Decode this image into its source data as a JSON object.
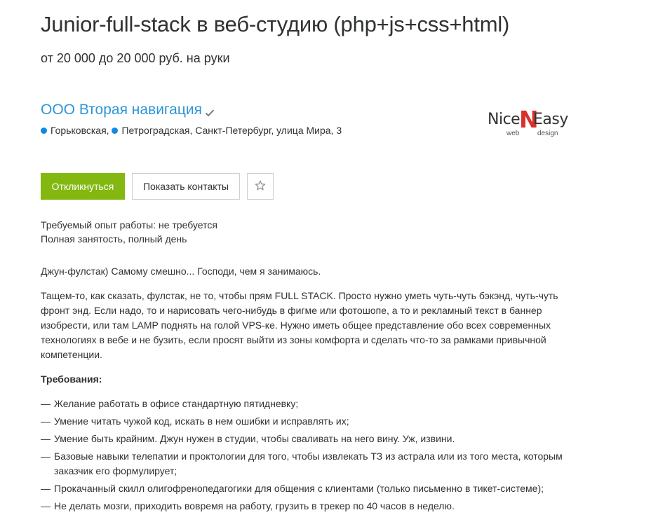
{
  "vacancy": {
    "title": "Junior-full-stack в веб-студию (php+js+css+html)",
    "salary": "от 20 000 до 20 000 руб. на руки"
  },
  "company": {
    "name": "ООО Вторая навигация",
    "verified_icon": "check-icon",
    "address": {
      "metro_1": "Горьковская",
      "metro_2": "Петроградская",
      "separator": ", ",
      "rest": ", Санкт-Петербург, улица Мира, 3",
      "metro_color": "#0f8ae0"
    },
    "logo": {
      "part1": "Nice",
      "part2": "N",
      "part3": "Easy",
      "sub1": "web",
      "sub2": "design",
      "accent_color": "#d9302c"
    }
  },
  "actions": {
    "apply_label": "Откликнуться",
    "contacts_label": "Показать контакты",
    "favorite_icon": "star-icon",
    "apply_color": "#82b80f"
  },
  "conditions": {
    "experience": "Требуемый опыт работы: не требуется",
    "employment": "Полная занятость, полный день"
  },
  "description": {
    "intro": "Джун-фулстак) Самому смешно... Господи, чем я занимаюсь.",
    "body": "Тащем-то, как сказать, фулстак, не то, чтобы прям FULL STACK. Просто нужно уметь чуть-чуть бэкэнд, чуть-чуть фронт энд. Если надо, то и нарисовать чего-нибудь в фигме или фотошопе, а то и рекламный текст в баннер изобрести, или там LAMP поднять на голой VPS-ке. Нужно иметь общее представление обо всех современных технологиях в вебе и не бузить, если просят выйти из зоны комфорта и сделать что-то за рамками привычной компетенции.",
    "requirements_title": "Требования:",
    "dash": "—",
    "requirements": [
      "Желание работать в офисе стандартную пятидневку;",
      "Умение читать чужой код, искать в нем ошибки и исправлять их;",
      "Умение быть крайним. Джун нужен в студии, чтобы сваливать на него вину. Уж, извини.",
      "Базовые навыки телепатии и проктологии для того, чтобы извлекать ТЗ из астрала или из того места, которым заказчик его формулирует;",
      "Прокачанный скилл олигофренопедагогики для общения с клиентами (только письменно в тикет-системе);",
      "Не делать мозги, приходить вовремя на работу, грузить в трекер по 40 часов в неделю."
    ]
  }
}
